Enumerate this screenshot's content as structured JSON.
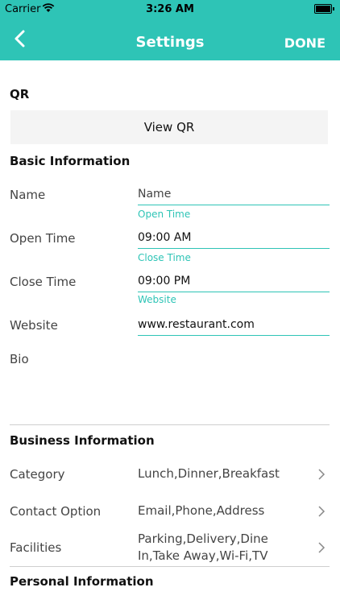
{
  "status_bar": {
    "carrier": "Carrier",
    "time": "3:26 AM"
  },
  "nav": {
    "title": "Settings",
    "done_label": "DONE",
    "back_icon": "chevron-left-icon"
  },
  "qr": {
    "section_title": "QR",
    "button_label": "View QR"
  },
  "basic": {
    "section_title": "Basic Information",
    "name_label": "Name",
    "name_placeholder": "Name",
    "open_time_label": "Open Time",
    "open_time_float": "Open Time",
    "open_time_value": "09:00 AM",
    "close_time_label": "Close Time",
    "close_time_float": "Close Time",
    "close_time_value": "09:00 PM",
    "website_label": "Website",
    "website_float": "Website",
    "website_value": "www.restaurant.com",
    "bio_label": "Bio"
  },
  "business": {
    "section_title": "Business Information",
    "rows": [
      {
        "label": "Category",
        "value": "Lunch,Dinner,Breakfast"
      },
      {
        "label": "Contact Option",
        "value": "Email,Phone,Address"
      },
      {
        "label": "Facilities",
        "value": "Parking,Delivery,Dine In,Take Away,Wi-Fi,TV"
      }
    ]
  },
  "personal": {
    "section_title": "Personal Information"
  },
  "colors": {
    "accent": "#2ec4b6"
  }
}
